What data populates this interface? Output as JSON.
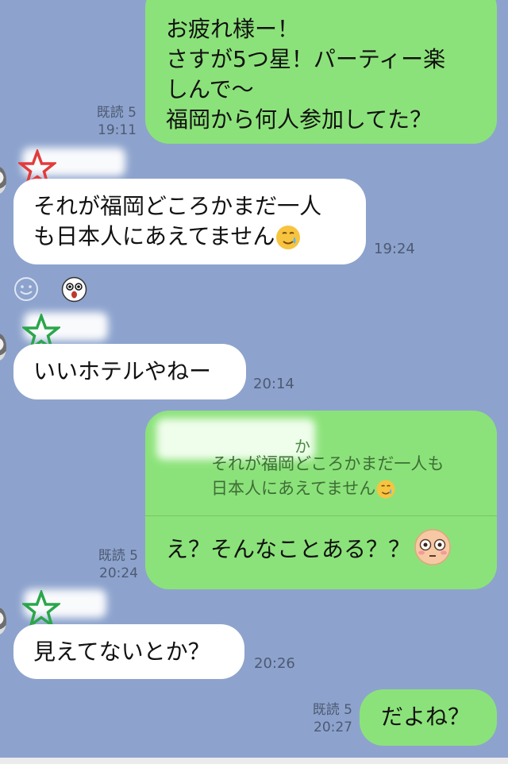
{
  "chat": {
    "messages": [
      {
        "side": "out",
        "lines": [
          "お疲れ様ー！",
          "さすが5つ星！パーティー楽",
          "しんで〜",
          "福岡から何人参加してた？"
        ],
        "read_label": "既読 5",
        "time": "19:11"
      },
      {
        "side": "in",
        "sender_blurred": "さちか",
        "star_color": "#e23b3b",
        "lines": [
          "それが福岡どころかまだ一人",
          "も日本人にあえてません"
        ],
        "emoji": "crying-smile",
        "time": "19:24",
        "reactions": [
          "smile-outline",
          "surprised-face"
        ]
      },
      {
        "side": "in",
        "sender_blurred": "i",
        "star_color": "#2aa64a",
        "lines": [
          "いいホテルやねー"
        ],
        "time": "20:14"
      },
      {
        "side": "out",
        "reply": {
          "sender_blurred": "か",
          "lines": [
            "それが福岡どころかまだ一人も",
            "日本人にあえてません"
          ],
          "emoji": "crying-smile"
        },
        "text": "え？そんなことある？？",
        "emoji": "flushed-face",
        "read_label": "既読 5",
        "time": "20:24"
      },
      {
        "side": "in",
        "sender_blurred": "i",
        "star_color": "#2aa64a",
        "lines": [
          "見えてないとか？"
        ],
        "time": "20:26"
      },
      {
        "side": "out",
        "lines": [
          "だよね？"
        ],
        "read_label": "既読 5",
        "time": "20:27"
      }
    ]
  }
}
